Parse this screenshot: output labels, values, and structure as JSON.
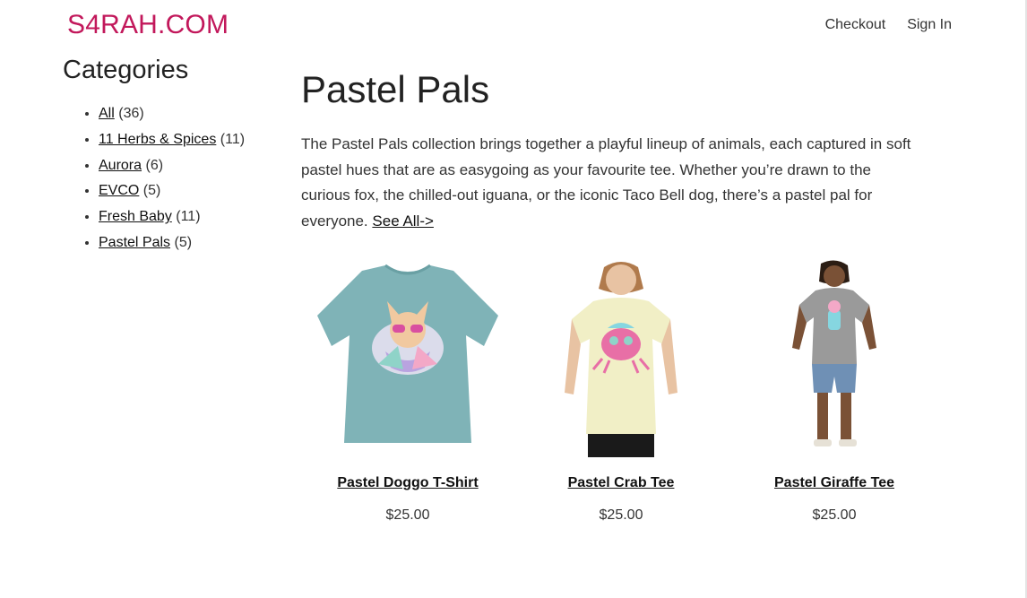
{
  "header": {
    "logo": "S4RAH.COM",
    "nav": [
      {
        "label": "Checkout"
      },
      {
        "label": "Sign In"
      }
    ]
  },
  "sidebar": {
    "title": "Categories",
    "items": [
      {
        "label": "All",
        "count": "(36)"
      },
      {
        "label": "11 Herbs & Spices",
        "count": "(11)"
      },
      {
        "label": "Aurora",
        "count": "(6)"
      },
      {
        "label": "EVCO",
        "count": "(5)"
      },
      {
        "label": "Fresh Baby",
        "count": "(11)"
      },
      {
        "label": "Pastel Pals",
        "count": "(5)"
      }
    ]
  },
  "main": {
    "title": "Pastel Pals",
    "description": "The Pastel Pals collection brings together a playful lineup of animals, each captured in soft pastel hues that are as easygoing as your favourite tee. Whether you’re drawn to the curious fox, the chilled-out iguana, or the iconic Taco Bell dog, there’s a pastel pal for everyone.",
    "see_all": "See All->"
  },
  "products": [
    {
      "name": "Pastel Doggo T-Shirt",
      "price": "$25.00"
    },
    {
      "name": "Pastel Crab Tee",
      "price": "$25.00"
    },
    {
      "name": "Pastel Giraffe Tee",
      "price": "$25.00"
    }
  ],
  "colors": {
    "brand": "#c2185b",
    "teal_shirt": "#7fb3b7",
    "yellow_shirt": "#f1efc6",
    "grey_shirt": "#9a9a9a"
  }
}
